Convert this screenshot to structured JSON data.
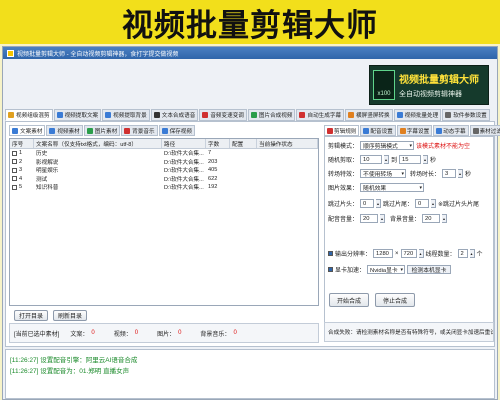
{
  "banner": {
    "title": "视频批量剪辑大师"
  },
  "window": {
    "title": "视频批量剪辑大师 - 全自动视频剪辑神器，食打字提交做视频"
  },
  "logo": {
    "badge": "x100",
    "main": "视频批量剪辑大师",
    "sub": "全自动视频剪辑神器"
  },
  "main_tabs": [
    {
      "label": "视频组级混剪",
      "color": "#e0a020"
    },
    {
      "label": "视频提取文案",
      "color": "#3a7bd5"
    },
    {
      "label": "视频提取背景",
      "color": "#3a7bd5"
    },
    {
      "label": "文本合成语音",
      "color": "#333333"
    },
    {
      "label": "音频变速变调",
      "color": "#d03030"
    },
    {
      "label": "图片合成视频",
      "color": "#2a9d4a"
    },
    {
      "label": "自动生成字幕",
      "color": "#d03030"
    },
    {
      "label": "横屏竖屏转换",
      "color": "#e08020"
    },
    {
      "label": "视频批量处理",
      "color": "#3a7bd5"
    },
    {
      "label": "软件参数设置",
      "color": "#666666"
    }
  ],
  "sub_tabs": [
    {
      "label": "文案素材",
      "color": "#3a7bd5"
    },
    {
      "label": "视频素材",
      "color": "#3a7bd5"
    },
    {
      "label": "图片素材",
      "color": "#2a9d4a"
    },
    {
      "label": "背景音乐",
      "color": "#d03030"
    },
    {
      "label": "保存视频",
      "color": "#3a7bd5"
    }
  ],
  "table": {
    "headers": [
      "序号",
      "文案名称（仅支持txt格式，编码：utf-8）",
      "路径",
      "字数",
      "配置",
      "当前操作状态"
    ],
    "rows": [
      {
        "seq": "1",
        "name": "历史",
        "path": "D:\\软件大合集...",
        "count": "7"
      },
      {
        "seq": "2",
        "name": "影视解说",
        "path": "D:\\软件大合集...",
        "count": "203"
      },
      {
        "seq": "3",
        "name": "明星娱乐",
        "path": "D:\\软件大合集...",
        "count": "405"
      },
      {
        "seq": "4",
        "name": "测试",
        "path": "D:\\软件大合集...",
        "count": "622"
      },
      {
        "seq": "5",
        "name": "知识科普",
        "path": "D:\\软件大合集...",
        "count": "192"
      }
    ]
  },
  "buttons": {
    "open_dir": "打开目录",
    "refresh_dir": "刷新目录",
    "start": "开始合成",
    "stop": "停止合成",
    "detect_gpu": "检测本机显卡"
  },
  "stats": {
    "selected_label": "[当前已选中素材]",
    "text_label": "文案：",
    "text_value": "0",
    "video_label": "视频：",
    "video_value": "0",
    "image_label": "图片：",
    "image_value": "0",
    "music_label": "背景音乐：",
    "music_value": "0"
  },
  "right_tabs": [
    {
      "label": "剪辑规则",
      "color": "#d03030"
    },
    {
      "label": "配音设置",
      "color": "#3a7bd5"
    },
    {
      "label": "字幕设置",
      "color": "#e08020"
    },
    {
      "label": "动态字幕",
      "color": "#3a7bd5"
    },
    {
      "label": "素材过滤",
      "color": "#666666"
    }
  ],
  "settings": {
    "mode_label": "剪辑模式：",
    "mode_value": "顺序剪辑模式",
    "mode_hint": "该模式素材不能为空",
    "random_label": "随机剪取：",
    "random_min": "10",
    "random_to": "到",
    "random_max": "15",
    "unit_sec": "秒",
    "transition_label": "转场特效：",
    "transition_value": "不使用转场",
    "transition_dur_label": "转场时长：",
    "transition_dur": "3",
    "image_fx_label": "图片效果：",
    "image_fx_value": "随机效果",
    "skip_head_label": "跳过片头：",
    "skip_head": "0",
    "skip_tail_label": "跳过片尾：",
    "skip_tail": "0",
    "skip_note": "※跳过片头片尾",
    "voice_vol_label": "配音音量：",
    "voice_vol": "20",
    "bgm_vol_label": "背景音量：",
    "bgm_vol": "20",
    "resolution_label": "输出分辨率：",
    "res_w": "1280",
    "res_x": "×",
    "res_h": "720",
    "threads_label": "线程数量：",
    "threads": "2",
    "threads_unit": "个",
    "gpu_label": "显卡加速：",
    "gpu_value": "Nvidia显卡"
  },
  "tip": "合成失败：请检测素材名称是否有特殊符号，或关闭显卡加速后重试",
  "log": [
    "[11:26:27] 设置配音引擎：阿里云AI语音合成",
    "[11:26:27] 设置配音为：01.郑明 直播女声"
  ]
}
